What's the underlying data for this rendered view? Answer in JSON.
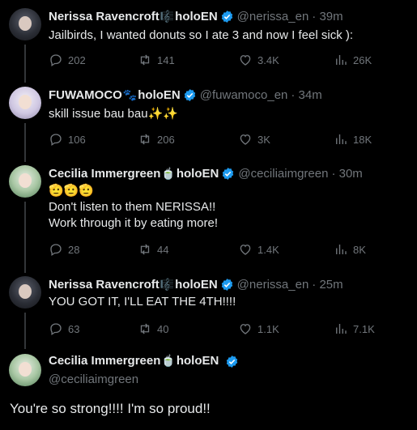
{
  "replies": [
    {
      "name": "Nerissa Ravencroft",
      "emoji": "🎼",
      "suffix": "holoEN",
      "handle": "@nerissa_en",
      "time": "· 39m",
      "lines": [
        "Jailbirds, I wanted donuts so I ate 3 and now I feel sick ):"
      ],
      "stats": {
        "replies": "202",
        "reposts": "141",
        "likes": "3.4K",
        "views": "26K"
      }
    },
    {
      "name": "FUWAMOCO",
      "emoji": "🐾",
      "suffix": "holoEN",
      "handle": "@fuwamoco_en",
      "time": "· 34m",
      "lines": [
        "skill issue bau bau✨✨"
      ],
      "stats": {
        "replies": "106",
        "reposts": "206",
        "likes": "3K",
        "views": "18K"
      }
    },
    {
      "name": "Cecilia Immergreen",
      "emoji": "🍵",
      "suffix": "holoEN",
      "handle": "@ceciliaimgreen",
      "time": "· 30m",
      "lines": [
        "🫡🫡🫡",
        "Don't listen to them NERISSA!!",
        "Work through it by eating more!"
      ],
      "stats": {
        "replies": "28",
        "reposts": "44",
        "likes": "1.4K",
        "views": "8K"
      }
    },
    {
      "name": "Nerissa Ravencroft",
      "emoji": "🎼",
      "suffix": "holoEN",
      "handle": "@nerissa_en",
      "time": "· 25m",
      "lines": [
        "YOU GOT IT, I'LL EAT THE 4TH!!!!"
      ],
      "stats": {
        "replies": "63",
        "reposts": "40",
        "likes": "1.1K",
        "views": "7.1K"
      }
    }
  ],
  "main": {
    "name": "Cecilia Immergreen",
    "emoji": "🍵",
    "suffix": "holoEN",
    "handle": "@ceciliaimgreen",
    "text": "You're so strong!!!! I'm so proud!!"
  },
  "colors": {
    "background": "#000000",
    "text": "#e7e9ea",
    "muted": "#71767b",
    "verified": "#1d9bf0",
    "thread_line": "#333639"
  }
}
